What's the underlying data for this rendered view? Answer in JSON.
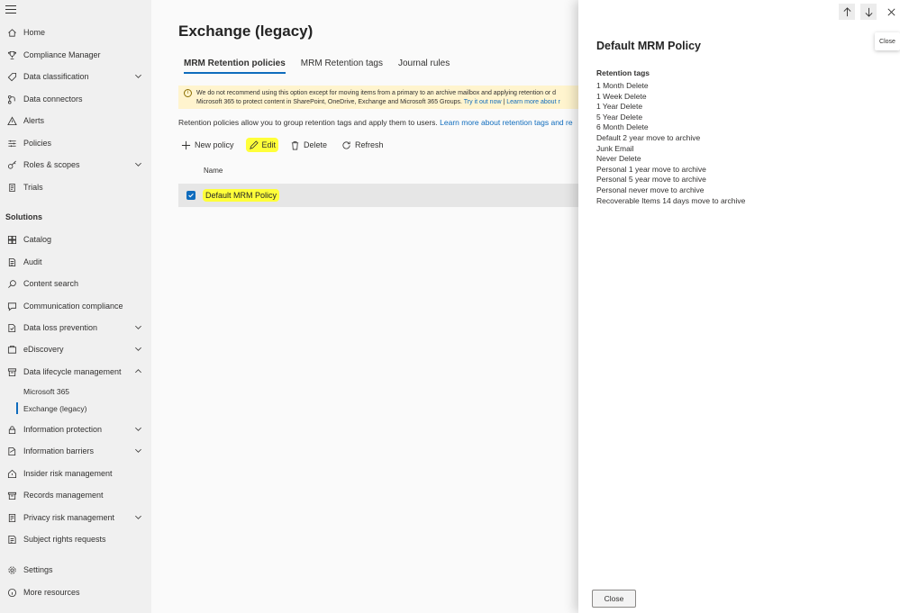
{
  "sidebar": {
    "items": [
      {
        "label": "Home",
        "icon": "home-icon",
        "chevron": false
      },
      {
        "label": "Compliance Manager",
        "icon": "trophy-icon",
        "chevron": false
      },
      {
        "label": "Data classification",
        "icon": "classification-icon",
        "chevron": true
      },
      {
        "label": "Data connectors",
        "icon": "connector-icon",
        "chevron": false
      },
      {
        "label": "Alerts",
        "icon": "alert-icon",
        "chevron": false
      },
      {
        "label": "Policies",
        "icon": "policies-icon",
        "chevron": false
      },
      {
        "label": "Roles & scopes",
        "icon": "key-icon",
        "chevron": true
      },
      {
        "label": "Trials",
        "icon": "trials-icon",
        "chevron": false
      }
    ],
    "solutions_heading": "Solutions",
    "solutions": [
      {
        "label": "Catalog",
        "icon": "catalog-icon",
        "chevron": false
      },
      {
        "label": "Audit",
        "icon": "audit-icon",
        "chevron": false
      },
      {
        "label": "Content search",
        "icon": "search-icon",
        "chevron": false
      },
      {
        "label": "Communication compliance",
        "icon": "chat-icon",
        "chevron": false
      },
      {
        "label": "Data loss prevention",
        "icon": "dlp-icon",
        "chevron": true
      },
      {
        "label": "eDiscovery",
        "icon": "ediscovery-icon",
        "chevron": true
      },
      {
        "label": "Data lifecycle management",
        "icon": "lifecycle-icon",
        "chevron": true,
        "expanded": true
      }
    ],
    "sub_items": [
      {
        "label": "Microsoft 365",
        "active": false
      },
      {
        "label": "Exchange (legacy)",
        "active": true
      }
    ],
    "more_solutions": [
      {
        "label": "Information protection",
        "icon": "lock-icon",
        "chevron": true
      },
      {
        "label": "Information barriers",
        "icon": "barrier-icon",
        "chevron": true
      },
      {
        "label": "Insider risk management",
        "icon": "insider-icon",
        "chevron": false
      },
      {
        "label": "Records management",
        "icon": "records-icon",
        "chevron": false
      },
      {
        "label": "Privacy risk management",
        "icon": "privacy-icon",
        "chevron": true
      },
      {
        "label": "Subject rights requests",
        "icon": "subject-icon",
        "chevron": false
      }
    ],
    "footer": [
      {
        "label": "Settings",
        "icon": "gear-icon"
      },
      {
        "label": "More resources",
        "icon": "info-icon"
      }
    ]
  },
  "main": {
    "title": "Exchange (legacy)",
    "tabs": [
      {
        "label": "MRM Retention policies",
        "active": true
      },
      {
        "label": "MRM Retention tags",
        "active": false
      },
      {
        "label": "Journal rules",
        "active": false
      }
    ],
    "warning": {
      "line1": "We do not recommend using this option except for moving items from a primary to an archive mailbox and applying retention or d",
      "line2": "Microsoft 365 to protect content in SharePoint, OneDrive, Exchange and Microsoft 365 Groups.",
      "link1": "Try it out now",
      "separator": "|",
      "link2": "Learn more about r"
    },
    "description": "Retention policies allow you to group retention tags and apply them to users.",
    "description_link": "Learn more about retention tags and re",
    "toolbar": {
      "new_policy": "New policy",
      "edit": "Edit",
      "delete": "Delete",
      "refresh": "Refresh"
    },
    "table": {
      "column_name": "Name",
      "rows": [
        {
          "name": "Default MRM Policy",
          "selected": true
        }
      ]
    }
  },
  "panel": {
    "title": "Default MRM Policy",
    "tags_heading": "Retention tags",
    "tags": [
      "1 Month Delete",
      "1 Week Delete",
      "1 Year Delete",
      "5 Year Delete",
      "6 Month Delete",
      "Default 2 year move to archive",
      "Junk Email",
      "Never Delete",
      "Personal 1 year move to archive",
      "Personal 5 year move to archive",
      "Personal never move to archive",
      "Recoverable Items 14 days move to archive"
    ],
    "tooltip": "Close",
    "close_button": "Close"
  },
  "colors": {
    "accent": "#0f6cbd",
    "highlight": "#ffff3a",
    "warning_bg": "#fff4ce",
    "sidebar_bg": "#f0f0f0"
  }
}
